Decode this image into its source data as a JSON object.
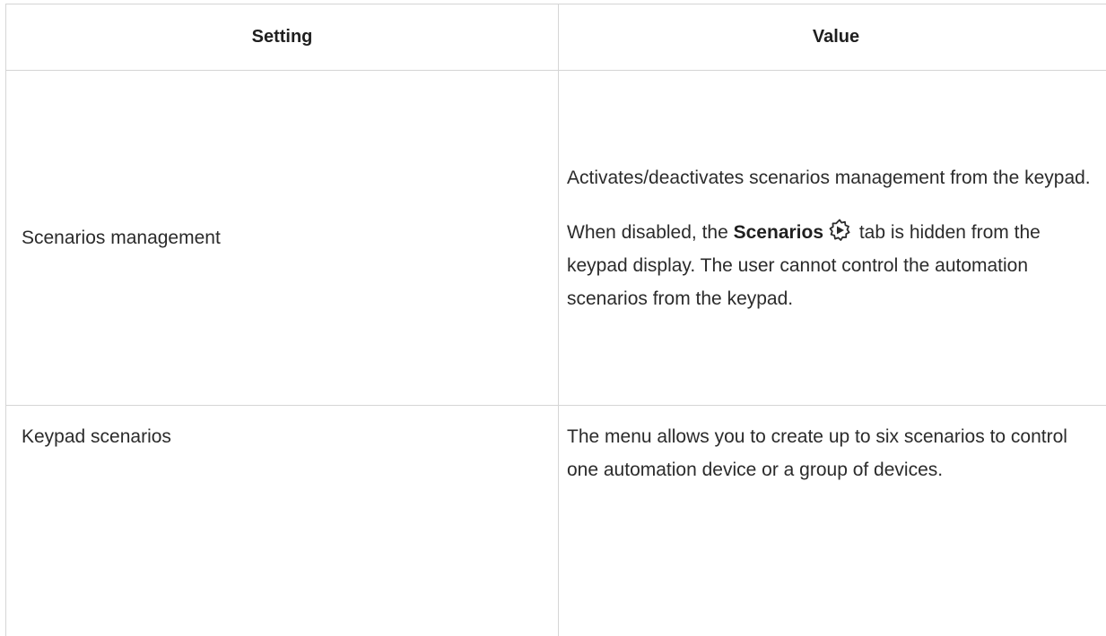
{
  "table": {
    "headers": {
      "setting": "Setting",
      "value": "Value"
    },
    "rows": [
      {
        "setting": "Scenarios management",
        "value": {
          "para1": "Activates/deactivates scenarios management from the keypad.",
          "para2_before": "When disabled, the ",
          "para2_bold": "Scenarios",
          "para2_icon": "scenarios-icon",
          "para2_after": " tab is hidden from the keypad display. The user cannot control the automation scenarios from the keypad."
        }
      },
      {
        "setting": "Keypad scenarios",
        "value": {
          "para1": "The menu allows you to create up to six scenarios to control one automation device or a group of devices."
        }
      }
    ]
  },
  "colors": {
    "border": "#d5d5d5",
    "text": "#2b2b2b"
  }
}
